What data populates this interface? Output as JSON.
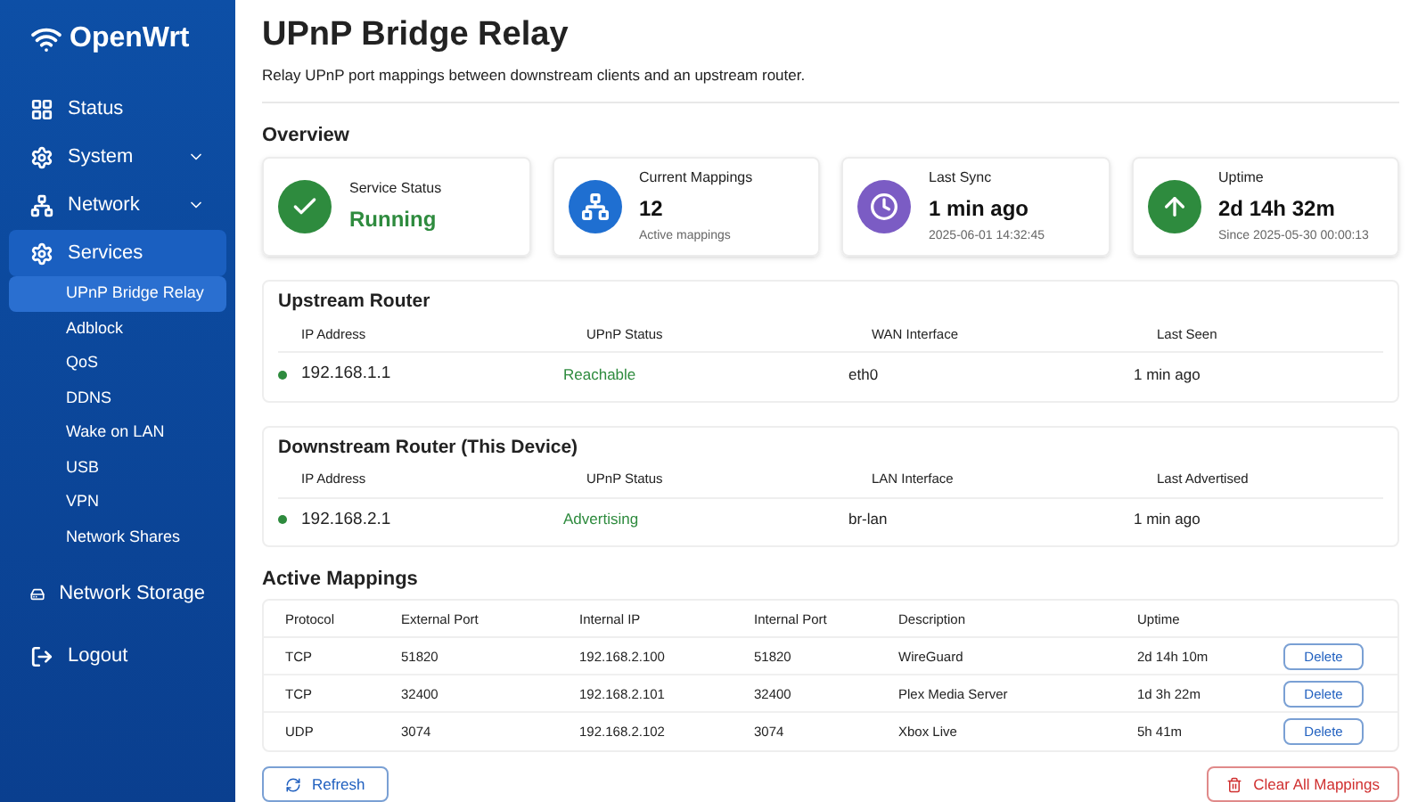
{
  "brand": {
    "name": "OpenWrt"
  },
  "sidebar": {
    "items": [
      {
        "label": "Status",
        "selected": false,
        "collapsible": false
      },
      {
        "label": "System",
        "selected": false,
        "collapsible": true
      },
      {
        "label": "Network",
        "selected": false,
        "collapsible": true
      },
      {
        "label": "Services",
        "selected": true,
        "collapsible": false,
        "children": [
          {
            "label": "UPnP Bridge Relay",
            "selected": true
          },
          {
            "label": "Adblock",
            "selected": false
          },
          {
            "label": "QoS",
            "selected": false
          },
          {
            "label": "DDNS",
            "selected": false
          },
          {
            "label": "Wake on LAN",
            "selected": false
          },
          {
            "label": "USB",
            "selected": false
          },
          {
            "label": "VPN",
            "selected": false
          },
          {
            "label": "Network Shares",
            "selected": false
          }
        ]
      },
      {
        "label": "Network Storage",
        "selected": false,
        "collapsible": false
      },
      {
        "label": "Logout",
        "selected": false,
        "collapsible": false
      }
    ]
  },
  "page": {
    "title": "UPnP Bridge Relay",
    "subtitle": "Relay UPnP port mappings between downstream clients and an upstream router."
  },
  "overview": {
    "heading": "Overview",
    "cards": [
      {
        "label": "Service Status",
        "value": "Running",
        "kind": "check",
        "color": "#2e8b3e"
      },
      {
        "label": "Current Mappings",
        "value": "12",
        "note": "Active mappings",
        "kind": "tree",
        "color": "#1f6fd1"
      },
      {
        "label": "Last Sync",
        "value": "1 min ago",
        "note": "2025-06-01 14:32:45",
        "kind": "clock",
        "color": "#7b5cc4"
      },
      {
        "label": "Uptime",
        "value": "2d 14h 32m",
        "note": "Since 2025-05-30 00:00:13",
        "kind": "arrow",
        "color": "#2e8b3e"
      }
    ]
  },
  "routers": [
    {
      "title": "Upstream Router",
      "columns": [
        "IP Address",
        "UPnP Status",
        "WAN Interface",
        "Last Seen"
      ],
      "row": {
        "ip": "192.168.1.1",
        "color": "#2e8b3e",
        "status": "Reachable",
        "interface": "eth0",
        "time": "1 min ago"
      }
    },
    {
      "title": "Downstream Router (This Device)",
      "columns": [
        "IP Address",
        "UPnP Status",
        "LAN Interface",
        "Last Advertised"
      ],
      "row": {
        "ip": "192.168.2.1",
        "color": "#2e8b3e",
        "status": "Advertising",
        "interface": "br-lan",
        "time": "1 min ago"
      }
    }
  ],
  "mappings": {
    "heading": "Active Mappings",
    "columns": [
      "Protocol",
      "External Port",
      "Internal IP",
      "Internal Port",
      "Description",
      "Uptime"
    ],
    "rows": [
      {
        "cells": [
          "TCP",
          "51820",
          "192.168.2.100",
          "51820",
          "WireGuard",
          "2d 14h 10m"
        ],
        "action": "Delete"
      },
      {
        "cells": [
          "TCP",
          "32400",
          "192.168.2.101",
          "32400",
          "Plex Media Server",
          "1d 3h 22m"
        ],
        "action": "Delete"
      },
      {
        "cells": [
          "UDP",
          "3074",
          "192.168.2.102",
          "3074",
          "Xbox Live",
          "5h 41m"
        ],
        "action": "Delete"
      }
    ]
  },
  "actions": {
    "refresh": "Refresh",
    "clear": "Clear All Mappings"
  }
}
